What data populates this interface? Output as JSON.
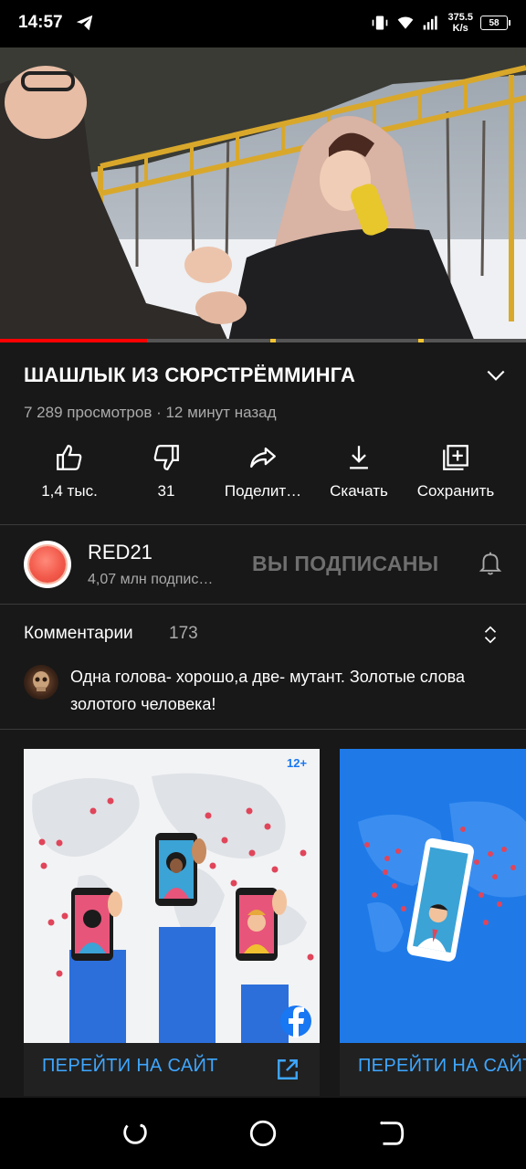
{
  "status_bar": {
    "time": "14:57",
    "speed_value": "375.5",
    "speed_unit": "K/s",
    "battery": "58",
    "icons": [
      "telegram-icon",
      "vibrate-icon",
      "wifi-icon",
      "signal-icon",
      "battery-icon"
    ]
  },
  "video": {
    "title": "ШАШЛЫК ИЗ СЮРСТРЁММИНГА",
    "meta": "7 289 просмотров · 12 минут назад",
    "progress": 0.28
  },
  "actions": [
    {
      "icon": "like-icon",
      "label": "1,4 тыс."
    },
    {
      "icon": "dislike-icon",
      "label": "31"
    },
    {
      "icon": "share-icon",
      "label": "Поделит…"
    },
    {
      "icon": "download-icon",
      "label": "Скачать"
    },
    {
      "icon": "save-playlist-icon",
      "label": "Сохранить"
    }
  ],
  "channel": {
    "name": "RED21",
    "subscribers": "4,07 млн подпис…",
    "subscribe_state": "ВЫ ПОДПИСАНЫ"
  },
  "comments": {
    "title": "Комментарии",
    "count": "173",
    "top_comment": "Одна голова- хорошо,а две- мутант. Золотые слова золотого человека!"
  },
  "ads": [
    {
      "badge": "12+",
      "cta": "ПЕРЕЙТИ НА САЙТ",
      "icon": "facebook-icon"
    },
    {
      "cta": "ПЕРЕЙТИ НА САЙТ"
    }
  ],
  "colors": {
    "background": "#181818",
    "accent_blue": "#3ea6ff",
    "progress_red": "#ff0000",
    "ad_blue": "#1877f2"
  }
}
